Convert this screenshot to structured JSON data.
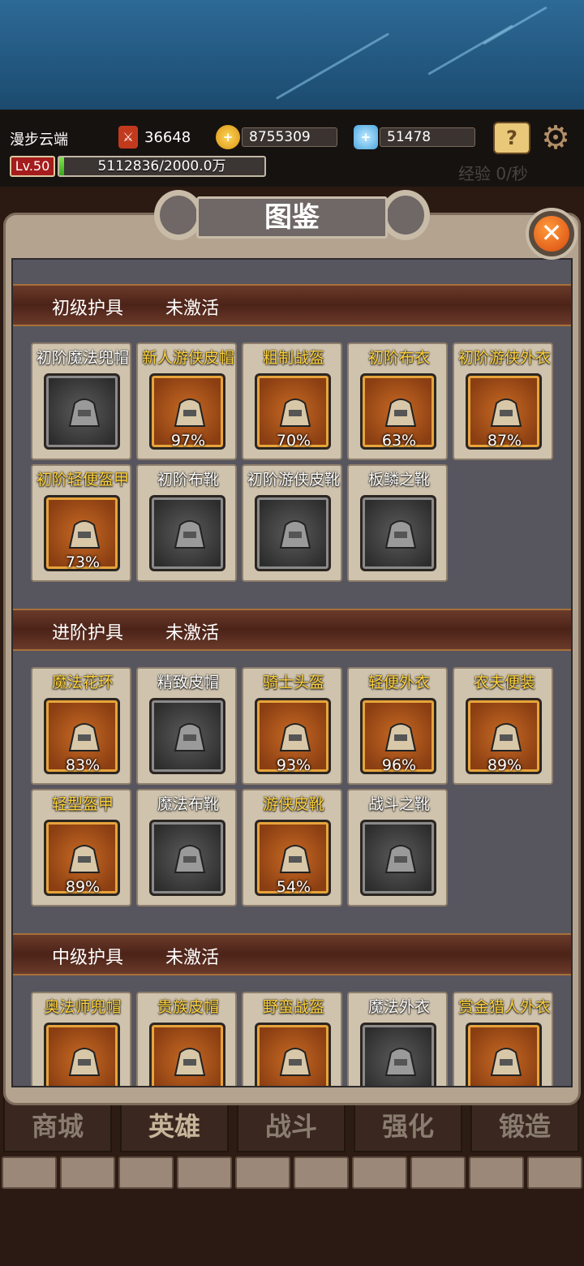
{
  "player": {
    "name": "漫步云端",
    "power": "36648",
    "gold": "8755309",
    "diamonds": "51478",
    "level": "Lv.50",
    "exp_text": "5112836/2000.0万",
    "exp_fraction": 0.0256,
    "exp_rate": "经验 0/秒"
  },
  "panel": {
    "title": "图鉴"
  },
  "sections": [
    {
      "name": "初级护具",
      "state": "未激活",
      "items": [
        {
          "name": "初阶魔法兜帽",
          "style": "gray",
          "gold": false,
          "pct": "",
          "icon": "wizard-hat-icon"
        },
        {
          "name": "新人游侠皮帽",
          "style": "orange",
          "gold": true,
          "pct": "97%",
          "icon": "feathered-hat-icon"
        },
        {
          "name": "粗制战盔",
          "style": "orange",
          "gold": true,
          "pct": "70%",
          "icon": "helmet-icon"
        },
        {
          "name": "初阶布衣",
          "style": "orange",
          "gold": true,
          "pct": "63%",
          "icon": "cloth-armor-icon"
        },
        {
          "name": "初阶游侠外衣",
          "style": "orange",
          "gold": true,
          "pct": "87%",
          "icon": "ranger-coat-icon"
        },
        {
          "name": "初阶轻便盔甲",
          "style": "orange",
          "gold": true,
          "pct": "73%",
          "icon": "light-armor-icon"
        },
        {
          "name": "初阶布靴",
          "style": "gray",
          "gold": false,
          "pct": "",
          "icon": "cloth-boots-icon"
        },
        {
          "name": "初阶游侠皮靴",
          "style": "gray",
          "gold": false,
          "pct": "",
          "icon": "leather-boots-icon"
        },
        {
          "name": "板鳞之靴",
          "style": "gray",
          "gold": false,
          "pct": "",
          "icon": "plate-boots-icon"
        }
      ]
    },
    {
      "name": "进阶护具",
      "state": "未激活",
      "items": [
        {
          "name": "魔法花环",
          "style": "orange",
          "gold": true,
          "pct": "83%",
          "icon": "wreath-icon"
        },
        {
          "name": "精致皮帽",
          "style": "gray",
          "gold": false,
          "pct": "",
          "icon": "goggles-cap-icon"
        },
        {
          "name": "骑士头盔",
          "style": "orange",
          "gold": true,
          "pct": "93%",
          "icon": "knight-helmet-icon"
        },
        {
          "name": "轻便外衣",
          "style": "orange",
          "gold": true,
          "pct": "96%",
          "icon": "light-coat-icon"
        },
        {
          "name": "农夫便装",
          "style": "orange",
          "gold": true,
          "pct": "89%",
          "icon": "farmer-clothes-icon"
        },
        {
          "name": "轻型盔甲",
          "style": "orange",
          "gold": true,
          "pct": "89%",
          "icon": "plate-armor-icon"
        },
        {
          "name": "魔法布靴",
          "style": "gray",
          "gold": false,
          "pct": "",
          "icon": "magic-boots-icon"
        },
        {
          "name": "游侠皮靴",
          "style": "orange",
          "gold": true,
          "pct": "54%",
          "icon": "ranger-boots-icon"
        },
        {
          "name": "战斗之靴",
          "style": "gray",
          "gold": false,
          "pct": "",
          "icon": "battle-boots-icon"
        }
      ]
    },
    {
      "name": "中级护具",
      "state": "未激活",
      "items": [
        {
          "name": "奥法师兜帽",
          "style": "orange",
          "gold": true,
          "pct": "",
          "icon": "arcane-hood-icon"
        },
        {
          "name": "贵族皮帽",
          "style": "orange",
          "gold": true,
          "pct": "",
          "icon": "noble-hat-icon"
        },
        {
          "name": "野蛮战盔",
          "style": "orange",
          "gold": true,
          "pct": "",
          "icon": "barbarian-helmet-icon"
        },
        {
          "name": "魔法外衣",
          "style": "gray",
          "gold": false,
          "pct": "",
          "icon": "magic-coat-icon"
        },
        {
          "name": "赏金猎人外衣",
          "style": "orange",
          "gold": true,
          "pct": "",
          "icon": "bounty-coat-icon"
        }
      ]
    }
  ],
  "nav": [
    "商城",
    "英雄",
    "战斗",
    "强化",
    "锻造"
  ],
  "colors": {
    "gold_text": "#ffd23a",
    "card_orange": "#c86a24",
    "card_gray": "#5b5b5b",
    "exp_green": "#5cc834",
    "close_orange": "#e25a16"
  }
}
